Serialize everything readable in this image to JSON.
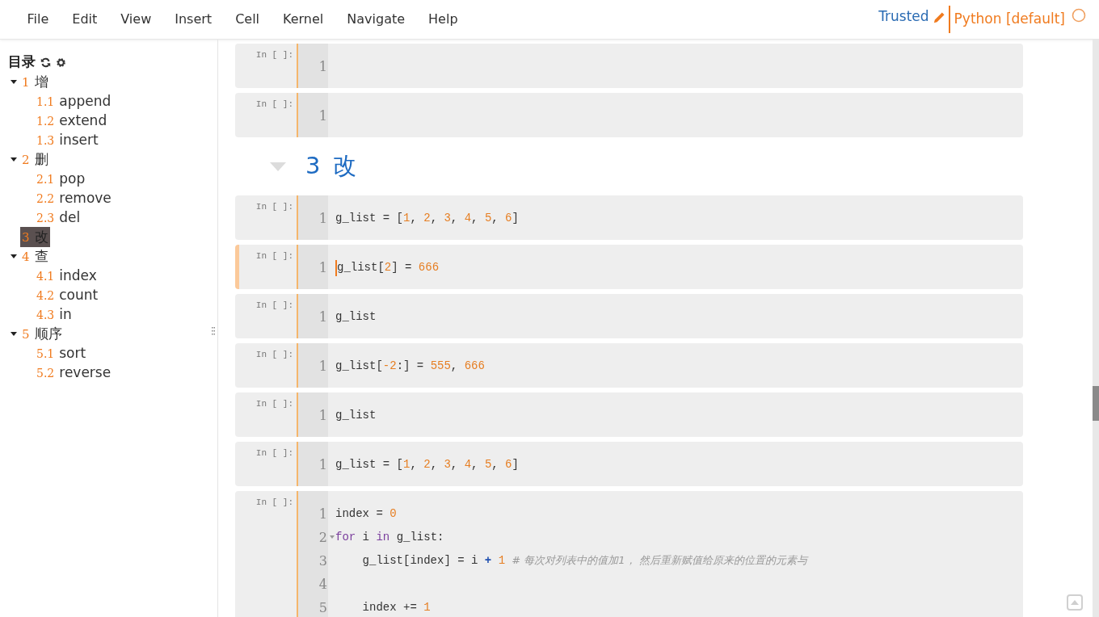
{
  "menu": [
    "File",
    "Edit",
    "View",
    "Insert",
    "Cell",
    "Kernel",
    "Navigate",
    "Help"
  ],
  "status": {
    "trusted": "Trusted",
    "kernel": "Python [default]"
  },
  "toc": {
    "title": "目录",
    "items": [
      {
        "number": "1",
        "label": "增",
        "expanded": true,
        "selected": false,
        "children": [
          {
            "number": "1.1",
            "label": "append",
            "selected": false
          },
          {
            "number": "1.2",
            "label": "extend",
            "selected": false
          },
          {
            "number": "1.3",
            "label": "insert",
            "selected": false
          }
        ]
      },
      {
        "number": "2",
        "label": "删",
        "expanded": true,
        "selected": false,
        "children": [
          {
            "number": "2.1",
            "label": "pop",
            "selected": false
          },
          {
            "number": "2.2",
            "label": "remove",
            "selected": false
          },
          {
            "number": "2.3",
            "label": "del",
            "selected": false
          }
        ]
      },
      {
        "number": "3",
        "label": "改",
        "expanded": false,
        "selected": true
      },
      {
        "number": "4",
        "label": "查",
        "expanded": true,
        "selected": false,
        "children": [
          {
            "number": "4.1",
            "label": "index",
            "selected": false
          },
          {
            "number": "4.2",
            "label": "count",
            "selected": false
          },
          {
            "number": "4.3",
            "label": "in",
            "selected": false
          }
        ]
      },
      {
        "number": "5",
        "label": "顺序",
        "expanded": true,
        "selected": false,
        "children": [
          {
            "number": "5.1",
            "label": "sort",
            "selected": false
          },
          {
            "number": "5.2",
            "label": "reverse",
            "selected": false
          }
        ]
      }
    ]
  },
  "cells": [
    {
      "kind": "code",
      "prompt": "In [ ]:",
      "selected": false,
      "lines": [
        {
          "number": "1"
        }
      ]
    },
    {
      "kind": "code",
      "prompt": "In [ ]:",
      "selected": false,
      "lines": [
        {
          "number": "1"
        }
      ]
    },
    {
      "kind": "heading",
      "number": "3",
      "text": "改"
    },
    {
      "kind": "code",
      "prompt": "In [ ]:",
      "selected": false,
      "lines": [
        {
          "number": "1",
          "tokens": [
            {
              "kind": "plain",
              "text": "g_list = ["
            },
            {
              "kind": "num",
              "text": "1"
            },
            {
              "kind": "plain",
              "text": ", "
            },
            {
              "kind": "num",
              "text": "2"
            },
            {
              "kind": "plain",
              "text": ", "
            },
            {
              "kind": "num",
              "text": "3"
            },
            {
              "kind": "plain",
              "text": ", "
            },
            {
              "kind": "num",
              "text": "4"
            },
            {
              "kind": "plain",
              "text": ", "
            },
            {
              "kind": "num",
              "text": "5"
            },
            {
              "kind": "plain",
              "text": ", "
            },
            {
              "kind": "num",
              "text": "6"
            },
            {
              "kind": "plain",
              "text": "]"
            }
          ]
        }
      ]
    },
    {
      "kind": "code",
      "prompt": "In [ ]:",
      "selected": true,
      "lines": [
        {
          "number": "1",
          "tokens": [
            {
              "kind": "plain",
              "text": "g_list["
            },
            {
              "kind": "num",
              "text": "2"
            },
            {
              "kind": "plain",
              "text": "] = "
            },
            {
              "kind": "num",
              "text": "666"
            }
          ]
        }
      ]
    },
    {
      "kind": "code",
      "prompt": "In [ ]:",
      "selected": false,
      "lines": [
        {
          "number": "1",
          "tokens": [
            {
              "kind": "plain",
              "text": "g_list"
            }
          ]
        }
      ]
    },
    {
      "kind": "code",
      "prompt": "In [ ]:",
      "selected": false,
      "lines": [
        {
          "number": "1",
          "tokens": [
            {
              "kind": "plain",
              "text": "g_list["
            },
            {
              "kind": "num",
              "text": "-2"
            },
            {
              "kind": "plain",
              "text": ":] = "
            },
            {
              "kind": "num",
              "text": "555"
            },
            {
              "kind": "plain",
              "text": ", "
            },
            {
              "kind": "num",
              "text": "666"
            }
          ]
        }
      ]
    },
    {
      "kind": "code",
      "prompt": "In [ ]:",
      "selected": false,
      "lines": [
        {
          "number": "1",
          "tokens": [
            {
              "kind": "plain",
              "text": "g_list"
            }
          ]
        }
      ]
    },
    {
      "kind": "code",
      "prompt": "In [ ]:",
      "selected": false,
      "lines": [
        {
          "number": "1",
          "tokens": [
            {
              "kind": "plain",
              "text": "g_list = ["
            },
            {
              "kind": "num",
              "text": "1"
            },
            {
              "kind": "plain",
              "text": ", "
            },
            {
              "kind": "num",
              "text": "2"
            },
            {
              "kind": "plain",
              "text": ", "
            },
            {
              "kind": "num",
              "text": "3"
            },
            {
              "kind": "plain",
              "text": ", "
            },
            {
              "kind": "num",
              "text": "4"
            },
            {
              "kind": "plain",
              "text": ", "
            },
            {
              "kind": "num",
              "text": "5"
            },
            {
              "kind": "plain",
              "text": ", "
            },
            {
              "kind": "num",
              "text": "6"
            },
            {
              "kind": "plain",
              "text": "]"
            }
          ]
        }
      ]
    },
    {
      "kind": "code",
      "prompt": "In [ ]:",
      "selected": false,
      "lines": [
        {
          "number": "1",
          "tokens": [
            {
              "kind": "plain",
              "text": "index = "
            },
            {
              "kind": "num",
              "text": "0"
            }
          ]
        },
        {
          "number": "2",
          "fold": true,
          "tokens": [
            {
              "kind": "keyword",
              "text": "for"
            },
            {
              "kind": "plain",
              "text": " i "
            },
            {
              "kind": "keyword",
              "text": "in"
            },
            {
              "kind": "plain",
              "text": " g_list:"
            }
          ]
        },
        {
          "number": "3",
          "tokens": [
            {
              "kind": "plain",
              "text": "    g_list[index] = i "
            },
            {
              "kind": "op",
              "text": "+"
            },
            {
              "kind": "num",
              "text": " 1"
            },
            {
              "kind": "comment",
              "text": "  # 每次对列表中的值加1， 然后重新赋值给原来的位置的元素与"
            }
          ]
        },
        {
          "number": "4"
        },
        {
          "number": "5",
          "tokens": [
            {
              "kind": "plain",
              "text": "    index += "
            },
            {
              "kind": "num",
              "text": "1"
            }
          ]
        }
      ]
    }
  ]
}
